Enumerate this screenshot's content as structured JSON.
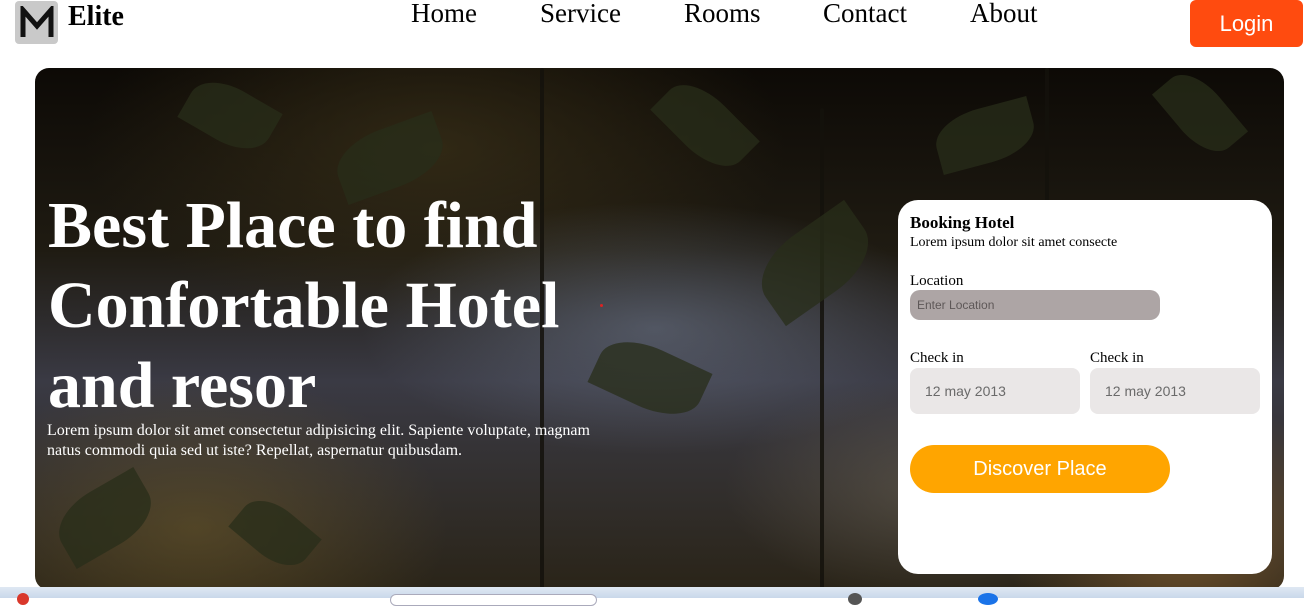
{
  "header": {
    "logo_letter": "M",
    "brand": "Elite",
    "nav": [
      "Home",
      "Service",
      "Rooms",
      "Contact",
      "About"
    ],
    "login_label": "Login"
  },
  "hero": {
    "title_line1": "Best Place to find",
    "title_line2": "Confortable Hotel",
    "title_line3": "and resor",
    "description": "Lorem ipsum dolor sit amet consectetur adipisicing elit. Sapiente voluptate, magnam natus commodi quia sed ut iste? Repellat, aspernatur quibusdam."
  },
  "booking": {
    "title": "Booking Hotel",
    "subtitle": "Lorem ipsum dolor sit amet consecte",
    "location_label": "Location",
    "location_placeholder": "Enter Location",
    "checkin_label": "Check in",
    "checkin_value": "12 may 2013",
    "checkin2_label": "Check in",
    "checkin2_value": "12 may 2013",
    "button_label": "Discover Place"
  },
  "colors": {
    "login_bg": "#ff4b0f",
    "discover_bg": "#ffa500",
    "location_input_bg": "#ada5a5",
    "date_box_bg": "#eae7e7"
  }
}
